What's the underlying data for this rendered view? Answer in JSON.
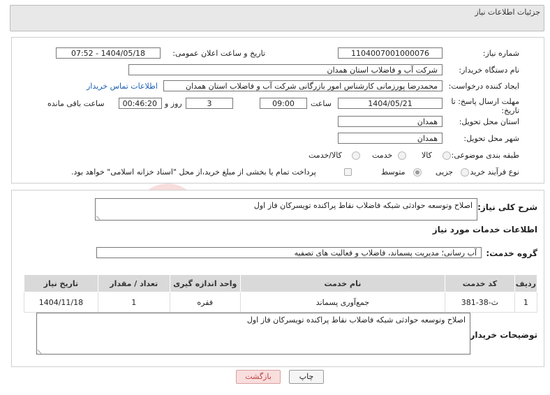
{
  "header": {
    "title": "جزئیات اطلاعات نیاز"
  },
  "form": {
    "need_number_label": "شماره نیاز:",
    "need_number": "1104007001000076",
    "announce_label": "تاریخ و ساعت اعلان عمومی:",
    "announce_value": "1404/05/18 - 07:52",
    "buyer_label": "نام دستگاه خریدار:",
    "buyer_value": "شرکت آب و فاضلاب استان همدان",
    "creator_label": "ایجاد کننده درخواست:",
    "creator_value": "محمدرضا پورزمانی کارشناس امور بازرگانی شرکت آب و فاضلاب استان همدان",
    "contact_link": "اطلاعات تماس خریدار",
    "deadline_label_1": "مهلت ارسال پاسخ: تا",
    "deadline_label_2": "تاریخ:",
    "deadline_date": "1404/05/21",
    "time_label": "ساعت",
    "deadline_time": "09:00",
    "days_value": "3",
    "days_label": "روز و",
    "remaining_time": "00:46:20",
    "remaining_label": "ساعت باقی مانده",
    "province_label": "استان محل تحویل:",
    "province_value": "همدان",
    "city_label": "شهر محل تحویل:",
    "city_value": "همدان",
    "category_label": "طبقه بندی موضوعی:",
    "category_options": [
      "کالا",
      "خدمت",
      "کالا/خدمت"
    ],
    "category_selected": "خدمت",
    "process_label": "نوع فرآیند خرید :",
    "process_options": [
      "جزیی",
      "متوسط"
    ],
    "process_selected": "متوسط",
    "payment_note": "پرداخت تمام یا بخشی از مبلغ خرید،از محل \"اسناد خزانه اسلامی\" خواهد بود."
  },
  "summary": {
    "label": "شرح کلی نیاز:",
    "value": "اصلاح وتوسعه حوادثی شبکه فاضلاب نقاط پراکنده تویسرکان فاز اول"
  },
  "services": {
    "section_title": "اطلاعات خدمات مورد نیاز",
    "group_label": "گروه خدمت:",
    "group_value": "آب رسانی؛ مدیریت پسماند، فاضلاب و فعالیت های تصفیه",
    "columns": [
      "ردیف",
      "کد خدمت",
      "نام خدمت",
      "واحد اندازه گیری",
      "تعداد / مقدار",
      "تاریخ نیاز"
    ],
    "rows": [
      [
        "1",
        "ث-38-381",
        "جمع‌آوری پسماند",
        "فقره",
        "1",
        "1404/11/18"
      ]
    ]
  },
  "buyer_notes": {
    "label": "توضیحات خریدار:",
    "value": "اصلاح وتوسعه حوادثی شبکه فاضلاب نقاط پراکنده تویسرکان فاز اول"
  },
  "buttons": {
    "print": "چاپ",
    "back": "بازگشت"
  },
  "watermark": {
    "text": "AriaTender.net"
  },
  "colors": {
    "link": "#1a5fb4",
    "back_button_bg": "#f9dede",
    "back_button_text": "#c04040"
  }
}
